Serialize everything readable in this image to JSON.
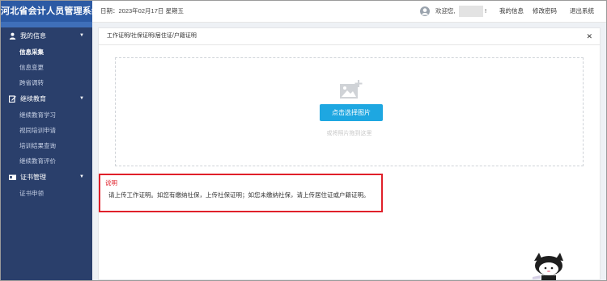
{
  "app": {
    "title": "河北省会计人员管理系统"
  },
  "topbar": {
    "date_text": "日期：2023年02月17日 星期五",
    "welcome": "欢迎您,",
    "exclaim": "!",
    "links": {
      "my_info": "我的信息",
      "change_password": "修改密码",
      "logout": "退出系统"
    }
  },
  "sidebar": {
    "groups": [
      {
        "label": "我的信息",
        "icon": "person-icon",
        "items": [
          "信息采集",
          "信息变更",
          "跨省调转"
        ]
      },
      {
        "label": "继续教育",
        "icon": "edit-icon",
        "items": [
          "继续教育学习",
          "视同培训申请",
          "培训结果查询",
          "继续教育评价"
        ]
      },
      {
        "label": "证书管理",
        "icon": "id-card-icon",
        "items": [
          "证书申领"
        ]
      }
    ],
    "active_item": "信息采集"
  },
  "panel": {
    "title": "工作证明/社保证明/居住证/户籍证明",
    "upload": {
      "button": "点击选择图片",
      "hint": "或将照片拖到这里"
    },
    "note": {
      "title": "说明",
      "body": "请上传工作证明。如您有缴纳社保，上传社保证明；如您未缴纳社保，请上传居住证或户籍证明。"
    }
  },
  "colors": {
    "sidebar_bg": "#2a3f6b",
    "brand_bg": "#2c5aa4",
    "accent": "#1ea7e1",
    "note_border": "#e0202a"
  }
}
